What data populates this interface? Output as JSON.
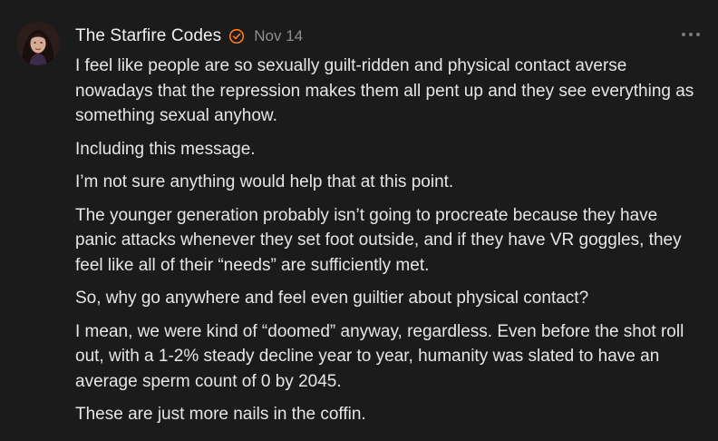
{
  "post": {
    "author": "The Starfire Codes",
    "date": "Nov 14",
    "paragraphs": [
      "I feel like people are so sexually guilt-ridden and physical contact averse nowadays that the repression makes them all pent up and they see everything as something sexual anyhow.",
      "Including this message.",
      "I’m not sure anything would help that at this point.",
      "The younger generation probably isn’t going to procreate because they have panic attacks whenever they set foot outside, and if they have VR goggles, they feel like all of their “needs” are sufficiently met.",
      "So, why go anywhere and feel even guiltier about physical contact?",
      "I mean, we were kind of “doomed” anyway, regardless. Even before the shot roll out, with a 1-2% steady decline year to year, humanity was slated to have an average sperm count of 0 by 2045.",
      "These are just more nails in the coffin."
    ]
  },
  "icons": {
    "verified": "verified-badge-icon",
    "more": "more-options-icon"
  },
  "colors": {
    "background": "#1b1b1b",
    "text": "#e6e6e6",
    "muted": "#8e8e8e",
    "accent": "#ff7a1a"
  }
}
